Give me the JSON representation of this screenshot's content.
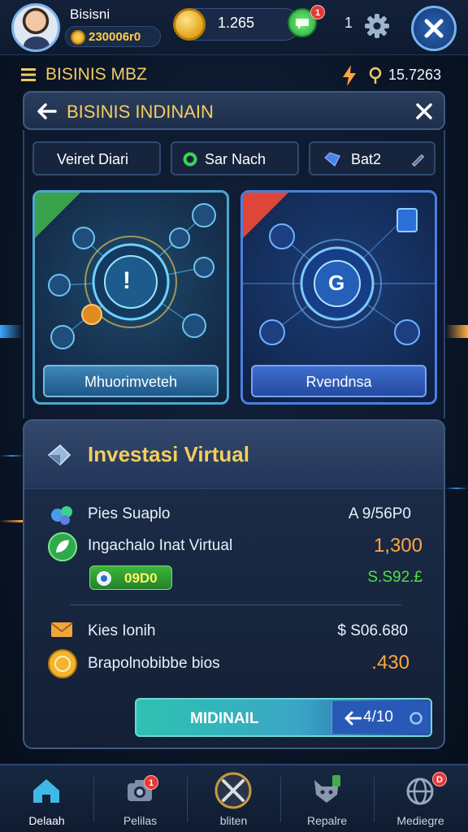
{
  "player": {
    "name": "Bisisni",
    "coins": "230006r0"
  },
  "header": {
    "gold": "1.265",
    "gem_badge": "1",
    "count": "1"
  },
  "strip": {
    "title": "BISINIS MBZ",
    "id": "15.7263"
  },
  "panel": {
    "title": "BISINIS INDINAIN"
  },
  "tabs": [
    {
      "label": "Veiret Diari"
    },
    {
      "label": "Sar Nach"
    },
    {
      "label": "Bat2"
    }
  ],
  "cards": [
    {
      "button": "Mhuorimveteh",
      "center_glyph": "!"
    },
    {
      "button": "Rvendnsa",
      "center_glyph": "G"
    }
  ],
  "investment": {
    "title": "Investasi Virtual",
    "rows": [
      {
        "label": "Pies Suaplo",
        "value": "A 9/56P0"
      },
      {
        "label": "Ingachalo Inat Virtual",
        "value": "1,300"
      },
      {
        "label": "",
        "value": "S.S92.£"
      },
      {
        "label": "Kies Ionih",
        "value": "$ S06.680"
      },
      {
        "label": "Brapolnobibbe bios",
        "value": ".430"
      }
    ],
    "chip": "09D0",
    "cta_label": "MIDINAIL",
    "cta_right": "4/10"
  },
  "nav": [
    {
      "label": "Delaah",
      "icon": "home-icon"
    },
    {
      "label": "Pelilas",
      "icon": "camera-icon",
      "badge": "1"
    },
    {
      "label": "bliten",
      "icon": "crossed-swords-icon"
    },
    {
      "label": "Repalre",
      "icon": "fox-icon"
    },
    {
      "label": "Mediegre",
      "icon": "globe-icon",
      "badge": "D"
    }
  ],
  "colors": {
    "gold_text": "#f4cd5c",
    "accent_blue": "#3ba9ff",
    "value_green": "#4ee04a",
    "value_orange": "#ffa640"
  }
}
